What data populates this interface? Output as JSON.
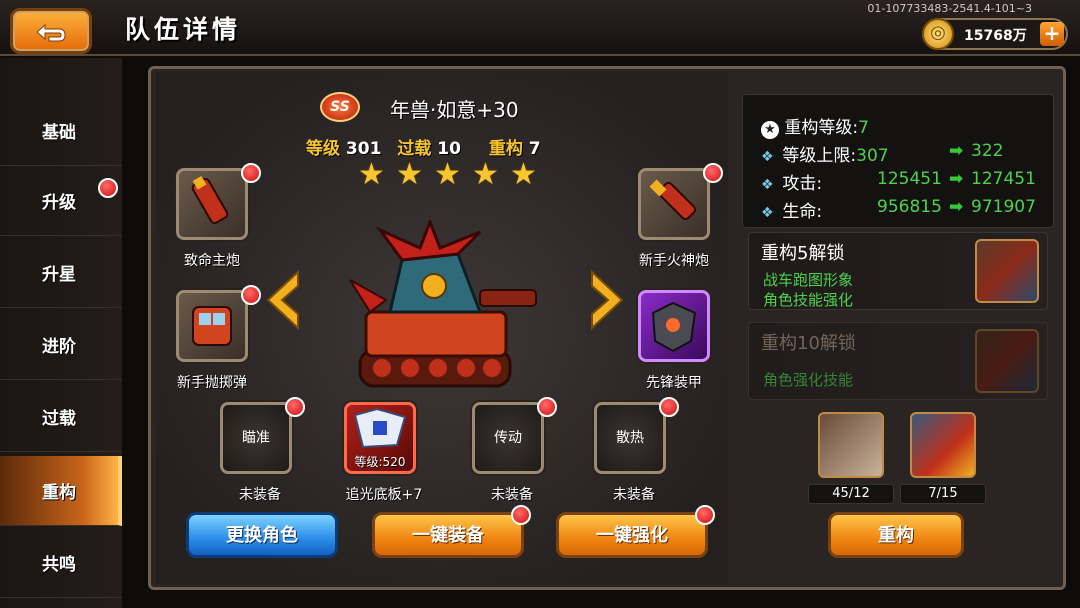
{
  "header": {
    "title": "队伍详情",
    "serial": "01-107733483-2541.4-101~3",
    "coins": "15768万",
    "coin_symbol": "◎",
    "plus": "+"
  },
  "sidebar": {
    "items": [
      {
        "label": "基础",
        "dot": false,
        "active": false
      },
      {
        "label": "升级",
        "dot": true,
        "active": false
      },
      {
        "label": "升星",
        "dot": false,
        "active": false
      },
      {
        "label": "进阶",
        "dot": false,
        "active": false
      },
      {
        "label": "过载",
        "dot": false,
        "active": false
      },
      {
        "label": "重构",
        "dot": false,
        "active": true
      },
      {
        "label": "共鸣",
        "dot": false,
        "active": false
      }
    ]
  },
  "vehicle": {
    "rank_badge": "SS",
    "name": "年兽·如意+30",
    "level_label": "等级",
    "level": "301",
    "overload_label": "过载",
    "overload": "10",
    "rebuild_label": "重构",
    "rebuild": "7",
    "stars": 5
  },
  "equipment": {
    "left": [
      {
        "label": "致命主炮",
        "icon": "rocket-cannon-icon"
      },
      {
        "label": "新手抛掷弹",
        "icon": "grenade-launcher-icon"
      }
    ],
    "right": [
      {
        "label": "新手火神炮",
        "icon": "gatling-gun-icon"
      },
      {
        "label": "先锋装甲",
        "icon": "armor-icon"
      }
    ],
    "bottom": [
      {
        "slot_text": "瞄准",
        "label": "未装备"
      },
      {
        "slot_text": "等级:520",
        "label": "追光底板+7"
      },
      {
        "slot_text": "传动",
        "label": "未装备"
      },
      {
        "slot_text": "散热",
        "label": "未装备"
      }
    ]
  },
  "buttons": {
    "change_role": "更换角色",
    "one_click_equip": "一键装备",
    "one_click_strengthen": "一键强化",
    "rebuild": "重构"
  },
  "stats": {
    "rebuild_level_label": "重构等级:",
    "rebuild_level": "7",
    "level_cap_label": "等级上限:",
    "level_cap_from": "307",
    "level_cap_to": "322",
    "attack_label": "攻击:",
    "attack_from": "125451",
    "attack_to": "127451",
    "hp_label": "生命:",
    "hp_from": "956815",
    "hp_to": "971907",
    "arrow": "➡"
  },
  "unlocks": [
    {
      "title": "重构5解锁",
      "lines": [
        "战车跑图形象",
        "角色技能强化"
      ],
      "dim": false
    },
    {
      "title": "重构10解锁",
      "lines": [
        "角色强化技能"
      ],
      "dim": true
    }
  ],
  "materials": [
    {
      "count": "45/12"
    },
    {
      "count": "7/15"
    }
  ],
  "colors": {
    "accent_orange": "#f08512",
    "accent_blue": "#2a8ce8",
    "stat_green": "#4ed24e",
    "red_dot": "#d10f0f"
  }
}
